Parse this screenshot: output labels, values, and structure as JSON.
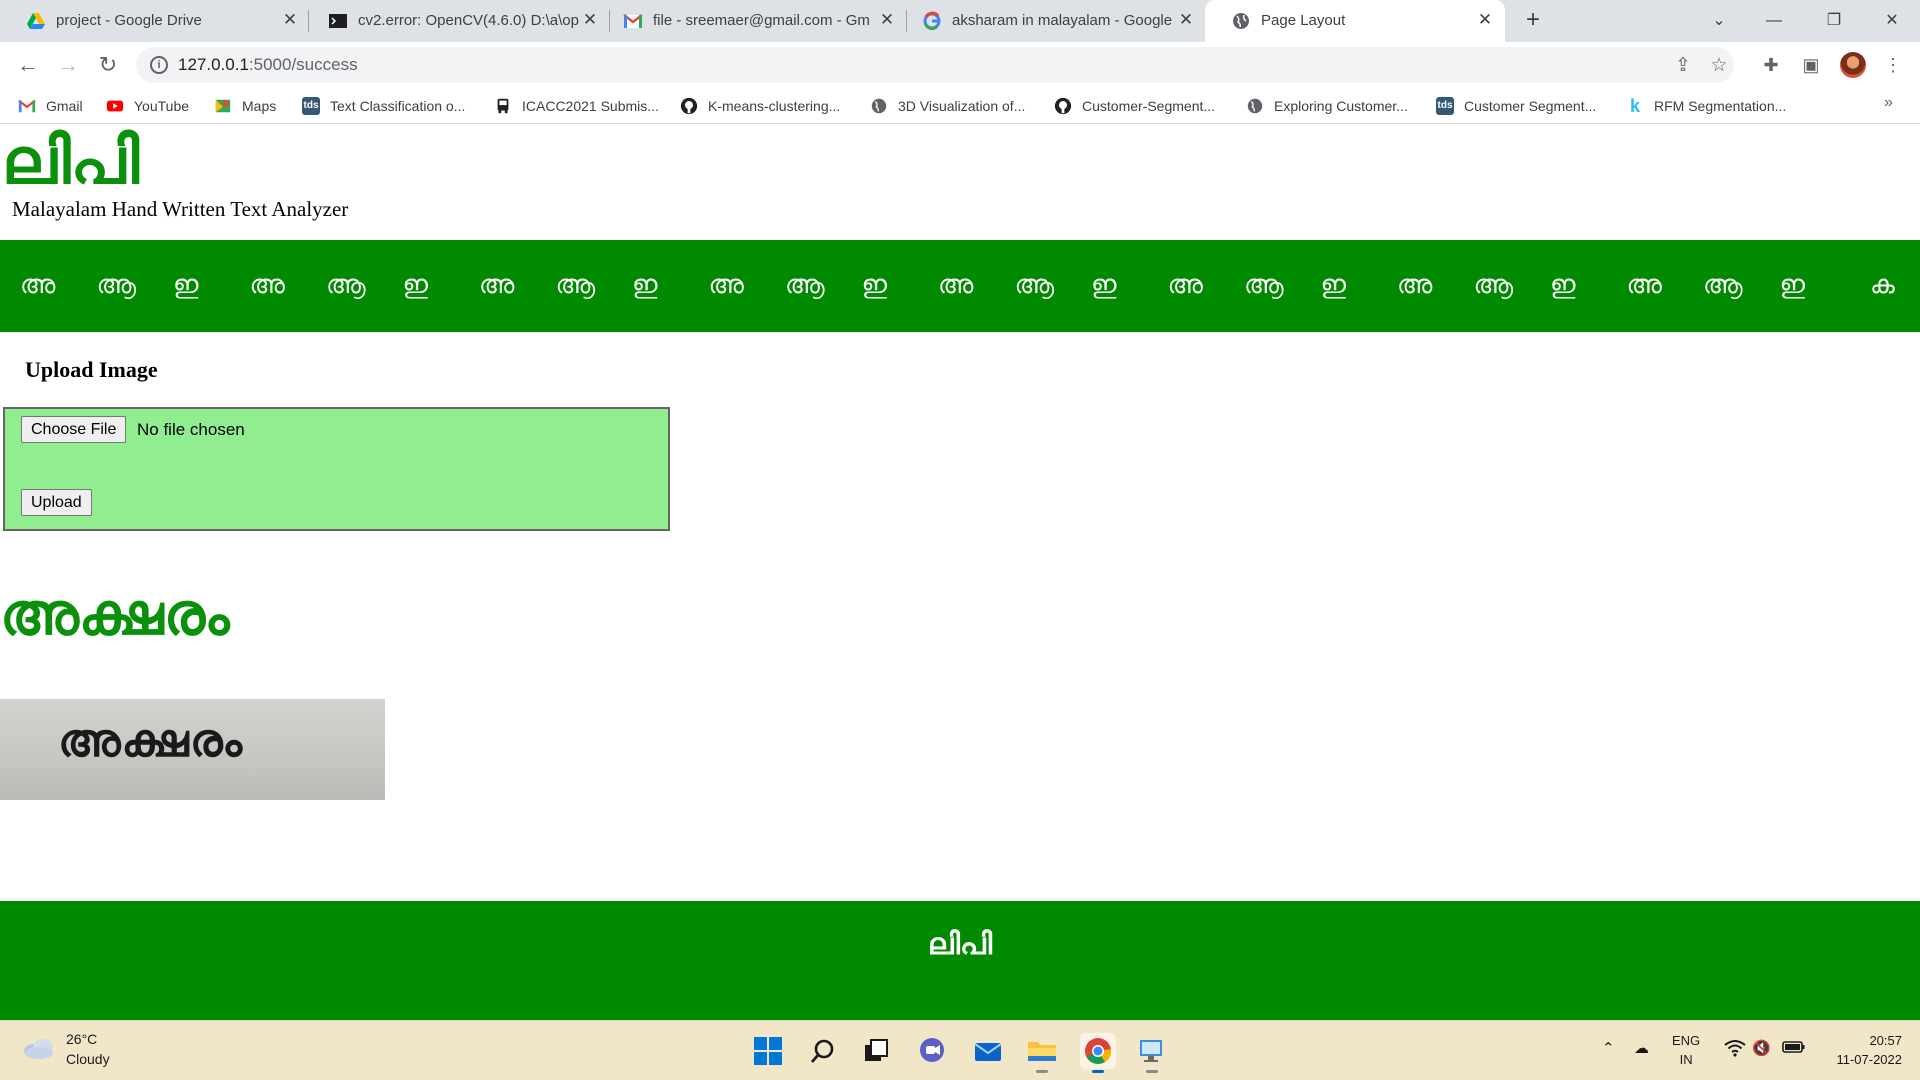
{
  "browser": {
    "tabs": [
      {
        "title": "project - Google Drive",
        "icon": "google-drive-icon"
      },
      {
        "title": "cv2.error: OpenCV(4.6.0) D:\\a\\op",
        "icon": "terminal-icon"
      },
      {
        "title": "file - sreemaer@gmail.com - Gm",
        "icon": "gmail-icon"
      },
      {
        "title": "aksharam in malayalam - Google",
        "icon": "google-icon"
      },
      {
        "title": "Page Layout",
        "icon": "globe-icon",
        "active": true
      }
    ],
    "url_host": "127.0.0.1",
    "url_path": ":5000/success",
    "bookmarks": [
      {
        "label": "Gmail",
        "icon": "gmail-icon"
      },
      {
        "label": "YouTube",
        "icon": "youtube-icon"
      },
      {
        "label": "Maps",
        "icon": "maps-icon"
      },
      {
        "label": "Text Classification o...",
        "icon": "tds-icon"
      },
      {
        "label": "ICACC2021 Submis...",
        "icon": "bus-icon"
      },
      {
        "label": "K-means-clustering...",
        "icon": "github-icon"
      },
      {
        "label": "3D Visualization of...",
        "icon": "globe-icon"
      },
      {
        "label": "Customer-Segment...",
        "icon": "github-icon"
      },
      {
        "label": "Exploring Customer...",
        "icon": "globe-icon"
      },
      {
        "label": "Customer Segment...",
        "icon": "tds-icon"
      },
      {
        "label": "RFM Segmentation...",
        "icon": "kaggle-icon"
      }
    ]
  },
  "page": {
    "logo": "ലിപി",
    "subtitle": "Malayalam Hand Written Text Analyzer",
    "letter_band": [
      "അ",
      "ആ",
      "ഇ",
      "അ",
      "ആ",
      "ഇ",
      "അ",
      "ആ",
      "ഇ",
      "അ",
      "ആ",
      "ഇ",
      "അ",
      "ആ",
      "ഇ",
      "അ",
      "ആ",
      "ഇ",
      "അ",
      "ആ",
      "ഇ",
      "അ",
      "ആ",
      "ഇ",
      "ക"
    ],
    "upload_heading": "Upload Image",
    "choose_file_label": "Choose File",
    "file_status": "No file chosen",
    "upload_label": "Upload",
    "result_word": "അക്ഷരം",
    "handwritten_sample": "അക്ഷരം",
    "footer": "ലിപി"
  },
  "taskbar": {
    "temperature": "26°C",
    "condition": "Cloudy",
    "language_line1": "ENG",
    "language_line2": "IN",
    "time": "20:57",
    "date": "11-07-2022"
  },
  "colors": {
    "brand_green": "#008a00",
    "title_green": "#0a900a",
    "upload_box": "#90ee90"
  }
}
